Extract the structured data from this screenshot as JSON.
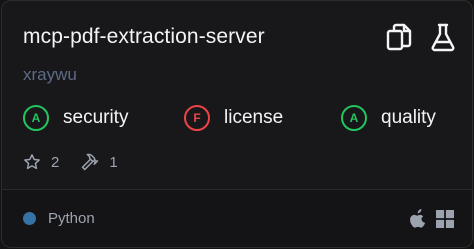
{
  "server": {
    "name": "mcp-pdf-extraction-server",
    "author": "xraywu"
  },
  "actions": {
    "copy_icon": "copy-icon",
    "test_icon": "flask-icon"
  },
  "scores": [
    {
      "grade": "A",
      "label": "security",
      "color": "#22c55e"
    },
    {
      "grade": "F",
      "label": "license",
      "color": "#ef4444"
    },
    {
      "grade": "A",
      "label": "quality",
      "color": "#22c55e"
    }
  ],
  "stats": {
    "stars": "2",
    "tools": "1"
  },
  "footer": {
    "language": "Python",
    "language_color": "#3572a5",
    "platforms": [
      "apple-icon",
      "windows-icon"
    ]
  }
}
